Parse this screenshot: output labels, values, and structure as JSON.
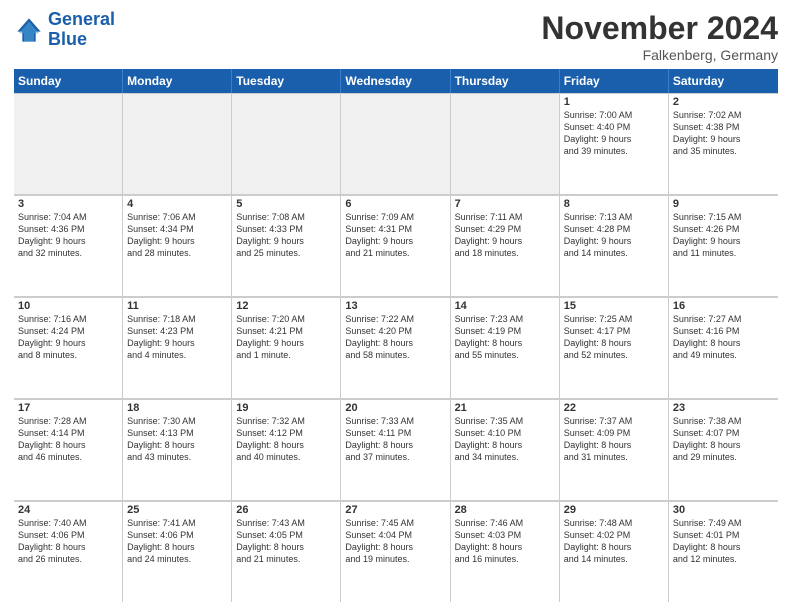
{
  "logo": {
    "text1": "General",
    "text2": "Blue"
  },
  "title": "November 2024",
  "subtitle": "Falkenberg, Germany",
  "headers": [
    "Sunday",
    "Monday",
    "Tuesday",
    "Wednesday",
    "Thursday",
    "Friday",
    "Saturday"
  ],
  "rows": [
    [
      {
        "day": "",
        "info": ""
      },
      {
        "day": "",
        "info": ""
      },
      {
        "day": "",
        "info": ""
      },
      {
        "day": "",
        "info": ""
      },
      {
        "day": "",
        "info": ""
      },
      {
        "day": "1",
        "info": "Sunrise: 7:00 AM\nSunset: 4:40 PM\nDaylight: 9 hours\nand 39 minutes."
      },
      {
        "day": "2",
        "info": "Sunrise: 7:02 AM\nSunset: 4:38 PM\nDaylight: 9 hours\nand 35 minutes."
      }
    ],
    [
      {
        "day": "3",
        "info": "Sunrise: 7:04 AM\nSunset: 4:36 PM\nDaylight: 9 hours\nand 32 minutes."
      },
      {
        "day": "4",
        "info": "Sunrise: 7:06 AM\nSunset: 4:34 PM\nDaylight: 9 hours\nand 28 minutes."
      },
      {
        "day": "5",
        "info": "Sunrise: 7:08 AM\nSunset: 4:33 PM\nDaylight: 9 hours\nand 25 minutes."
      },
      {
        "day": "6",
        "info": "Sunrise: 7:09 AM\nSunset: 4:31 PM\nDaylight: 9 hours\nand 21 minutes."
      },
      {
        "day": "7",
        "info": "Sunrise: 7:11 AM\nSunset: 4:29 PM\nDaylight: 9 hours\nand 18 minutes."
      },
      {
        "day": "8",
        "info": "Sunrise: 7:13 AM\nSunset: 4:28 PM\nDaylight: 9 hours\nand 14 minutes."
      },
      {
        "day": "9",
        "info": "Sunrise: 7:15 AM\nSunset: 4:26 PM\nDaylight: 9 hours\nand 11 minutes."
      }
    ],
    [
      {
        "day": "10",
        "info": "Sunrise: 7:16 AM\nSunset: 4:24 PM\nDaylight: 9 hours\nand 8 minutes."
      },
      {
        "day": "11",
        "info": "Sunrise: 7:18 AM\nSunset: 4:23 PM\nDaylight: 9 hours\nand 4 minutes."
      },
      {
        "day": "12",
        "info": "Sunrise: 7:20 AM\nSunset: 4:21 PM\nDaylight: 9 hours\nand 1 minute."
      },
      {
        "day": "13",
        "info": "Sunrise: 7:22 AM\nSunset: 4:20 PM\nDaylight: 8 hours\nand 58 minutes."
      },
      {
        "day": "14",
        "info": "Sunrise: 7:23 AM\nSunset: 4:19 PM\nDaylight: 8 hours\nand 55 minutes."
      },
      {
        "day": "15",
        "info": "Sunrise: 7:25 AM\nSunset: 4:17 PM\nDaylight: 8 hours\nand 52 minutes."
      },
      {
        "day": "16",
        "info": "Sunrise: 7:27 AM\nSunset: 4:16 PM\nDaylight: 8 hours\nand 49 minutes."
      }
    ],
    [
      {
        "day": "17",
        "info": "Sunrise: 7:28 AM\nSunset: 4:14 PM\nDaylight: 8 hours\nand 46 minutes."
      },
      {
        "day": "18",
        "info": "Sunrise: 7:30 AM\nSunset: 4:13 PM\nDaylight: 8 hours\nand 43 minutes."
      },
      {
        "day": "19",
        "info": "Sunrise: 7:32 AM\nSunset: 4:12 PM\nDaylight: 8 hours\nand 40 minutes."
      },
      {
        "day": "20",
        "info": "Sunrise: 7:33 AM\nSunset: 4:11 PM\nDaylight: 8 hours\nand 37 minutes."
      },
      {
        "day": "21",
        "info": "Sunrise: 7:35 AM\nSunset: 4:10 PM\nDaylight: 8 hours\nand 34 minutes."
      },
      {
        "day": "22",
        "info": "Sunrise: 7:37 AM\nSunset: 4:09 PM\nDaylight: 8 hours\nand 31 minutes."
      },
      {
        "day": "23",
        "info": "Sunrise: 7:38 AM\nSunset: 4:07 PM\nDaylight: 8 hours\nand 29 minutes."
      }
    ],
    [
      {
        "day": "24",
        "info": "Sunrise: 7:40 AM\nSunset: 4:06 PM\nDaylight: 8 hours\nand 26 minutes."
      },
      {
        "day": "25",
        "info": "Sunrise: 7:41 AM\nSunset: 4:06 PM\nDaylight: 8 hours\nand 24 minutes."
      },
      {
        "day": "26",
        "info": "Sunrise: 7:43 AM\nSunset: 4:05 PM\nDaylight: 8 hours\nand 21 minutes."
      },
      {
        "day": "27",
        "info": "Sunrise: 7:45 AM\nSunset: 4:04 PM\nDaylight: 8 hours\nand 19 minutes."
      },
      {
        "day": "28",
        "info": "Sunrise: 7:46 AM\nSunset: 4:03 PM\nDaylight: 8 hours\nand 16 minutes."
      },
      {
        "day": "29",
        "info": "Sunrise: 7:48 AM\nSunset: 4:02 PM\nDaylight: 8 hours\nand 14 minutes."
      },
      {
        "day": "30",
        "info": "Sunrise: 7:49 AM\nSunset: 4:01 PM\nDaylight: 8 hours\nand 12 minutes."
      }
    ]
  ]
}
